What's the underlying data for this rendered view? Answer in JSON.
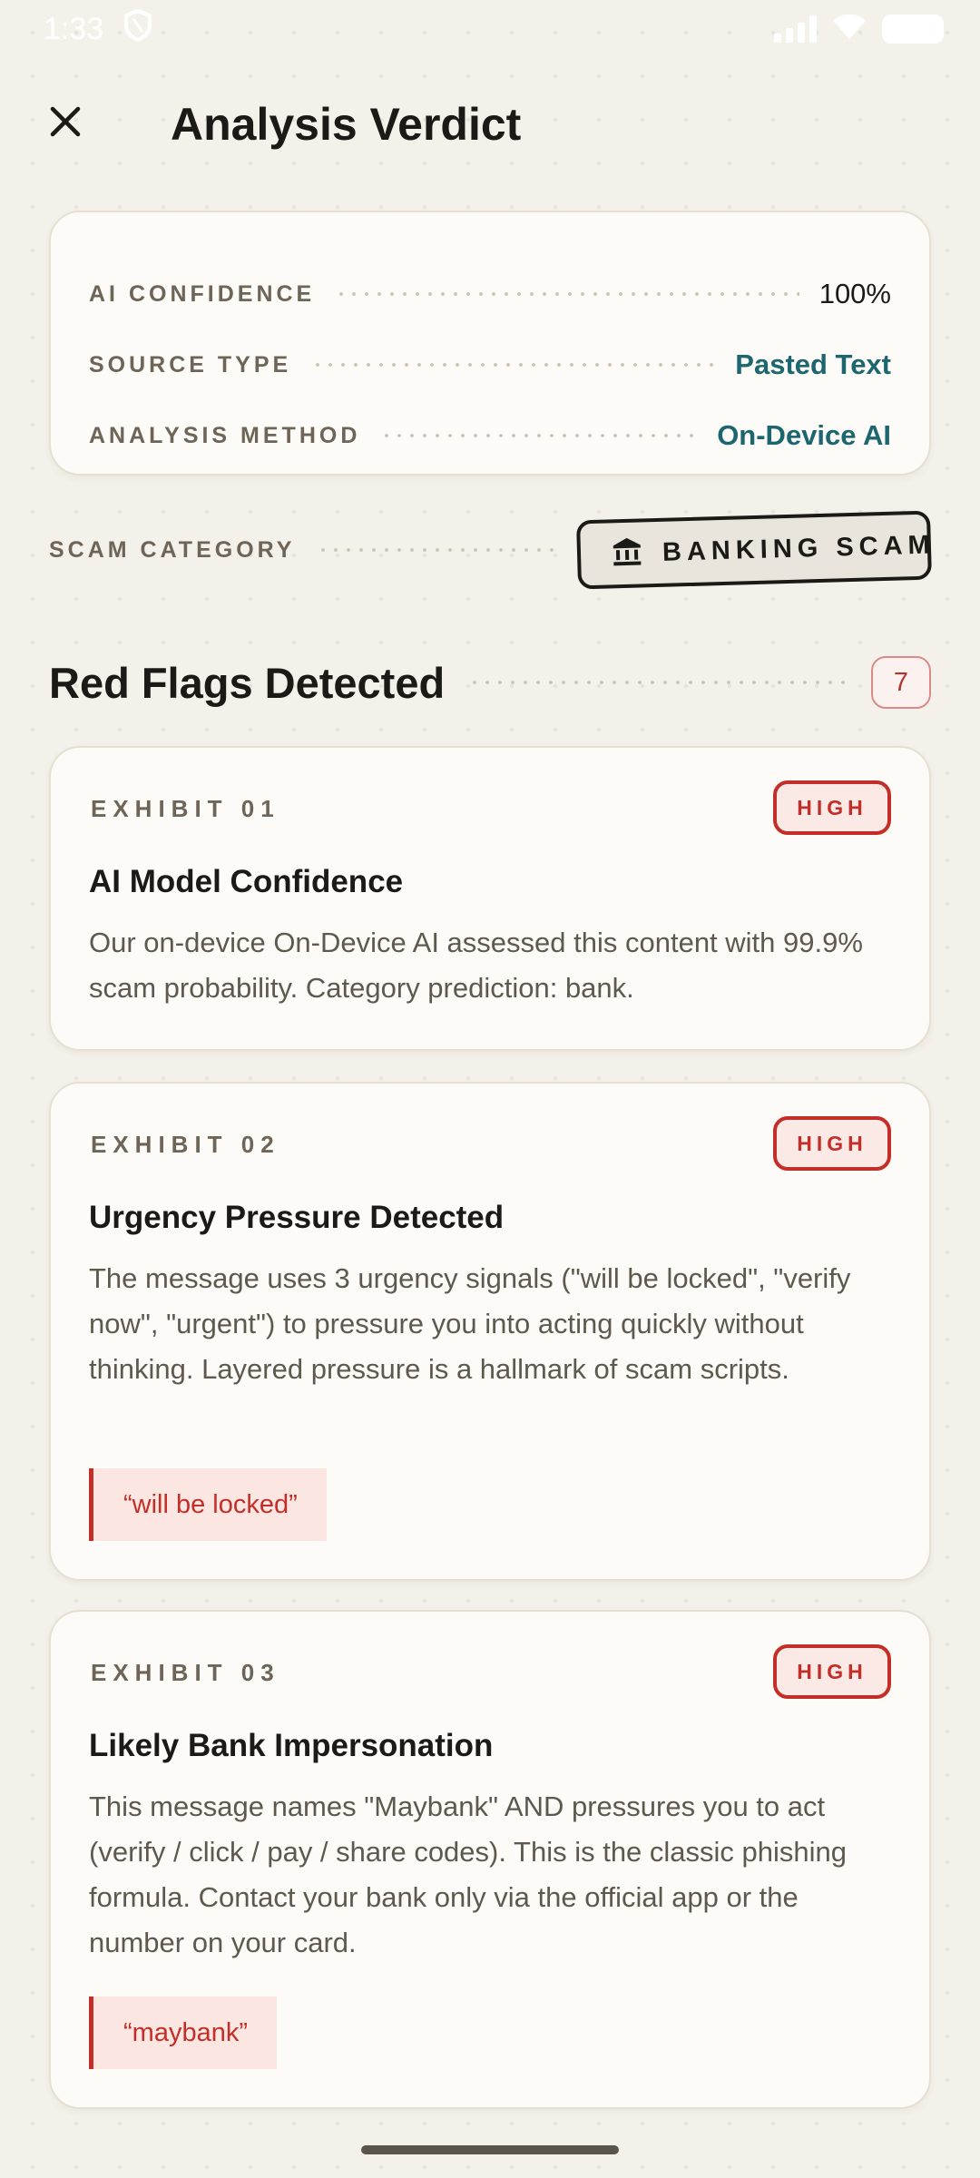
{
  "status_bar": {
    "time": "1:33"
  },
  "header": {
    "title": "Analysis Verdict"
  },
  "meta": {
    "rows": [
      {
        "label": "AI CONFIDENCE",
        "value": "100%"
      },
      {
        "label": "SOURCE TYPE",
        "value": "Pasted Text"
      },
      {
        "label": "ANALYSIS METHOD",
        "value": "On-Device AI"
      }
    ]
  },
  "category": {
    "label": "SCAM CATEGORY",
    "value": "BANKING SCAM"
  },
  "red_flags": {
    "title": "Red Flags Detected",
    "count": "7",
    "exhibits": [
      {
        "label": "EXHIBIT 01",
        "severity": "HIGH",
        "title": "AI Model Confidence",
        "body": "Our on-device On-Device AI assessed this content with 99.9% scam probability. Category prediction: bank."
      },
      {
        "label": "EXHIBIT 02",
        "severity": "HIGH",
        "title": "Urgency Pressure Detected",
        "body": "The message uses 3 urgency signals (\"will be locked\", \"verify now\", \"urgent\") to pressure you into acting quickly without thinking. Layered pressure is a hallmark of scam scripts.",
        "quote": "“will be locked”"
      },
      {
        "label": "EXHIBIT 03",
        "severity": "HIGH",
        "title": "Likely Bank Impersonation",
        "body": "This message names \"Maybank\" AND pressures you to act (verify / click / pay / share codes). This is the classic phishing formula. Contact your bank only via the official app or the number on your card.",
        "quote": "“maybank”"
      }
    ]
  },
  "colors": {
    "background": "#f4f1ea",
    "accent_teal": "#1d6670",
    "danger_red": "#c42e28"
  }
}
